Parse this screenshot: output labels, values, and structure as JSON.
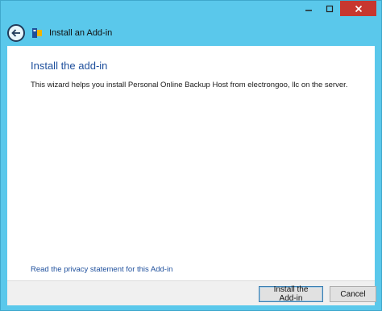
{
  "window": {
    "caption_minimize": "—",
    "caption_maximize": "□",
    "caption_close": "✕"
  },
  "header": {
    "title": "Install an Add-in",
    "back_icon": "back-arrow-icon",
    "app_icon": "add-in-icon"
  },
  "content": {
    "title": "Install the add-in",
    "description": "This wizard helps you install Personal Online Backup Host from electrongoo, llc on the server.",
    "privacy_link": "Read the privacy statement for this Add-in"
  },
  "footer": {
    "install_label": "Install the Add-in",
    "cancel_label": "Cancel"
  },
  "colors": {
    "frame": "#5ac8eb",
    "title_text": "#1e4f9c",
    "close_button": "#c7372f"
  }
}
